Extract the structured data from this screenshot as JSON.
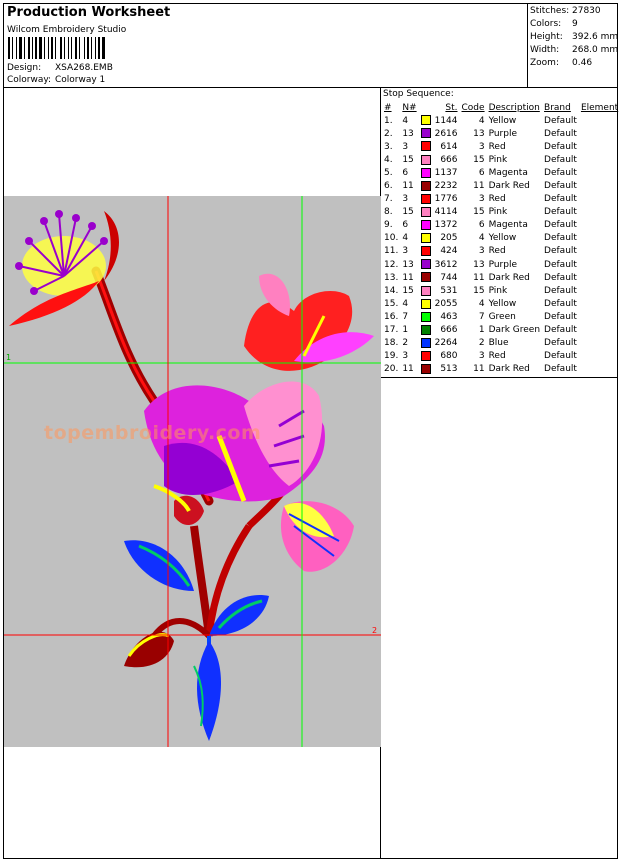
{
  "header": {
    "title": "Production Worksheet",
    "company": "Wilcom Embroidery Studio",
    "design_label": "Design:",
    "design_value": "XSA268.EMB",
    "colorway_label": "Colorway:",
    "colorway_value": "Colorway 1"
  },
  "stats": [
    {
      "label": "Stitches:",
      "value": "27830"
    },
    {
      "label": "Colors:",
      "value": "9"
    },
    {
      "label": "Height:",
      "value": "392.6 mm"
    },
    {
      "label": "Width:",
      "value": "268.0 mm"
    },
    {
      "label": "Zoom:",
      "value": "0.46"
    }
  ],
  "preview": {
    "watermark": "topembroidery.com",
    "background": "#c0c0c0",
    "guide_h_labels": [
      "1",
      "2"
    ]
  },
  "stop_sequence": {
    "title": "Stop Sequence:",
    "columns": [
      "#",
      "N#",
      "St.",
      "Code",
      "Description",
      "Brand",
      "Element"
    ],
    "rows": [
      {
        "idx": "1.",
        "n": "4",
        "color": "#ffff00",
        "st": "1144",
        "code": "4",
        "desc": "Yellow",
        "brand": "Default"
      },
      {
        "idx": "2.",
        "n": "13",
        "color": "#9900cc",
        "st": "2616",
        "code": "13",
        "desc": "Purple",
        "brand": "Default"
      },
      {
        "idx": "3.",
        "n": "3",
        "color": "#ff0000",
        "st": "614",
        "code": "3",
        "desc": "Red",
        "brand": "Default"
      },
      {
        "idx": "4.",
        "n": "15",
        "color": "#ff80c0",
        "st": "666",
        "code": "15",
        "desc": "Pink",
        "brand": "Default"
      },
      {
        "idx": "5.",
        "n": "6",
        "color": "#ff00ff",
        "st": "1137",
        "code": "6",
        "desc": "Magenta",
        "brand": "Default"
      },
      {
        "idx": "6.",
        "n": "11",
        "color": "#990000",
        "st": "2232",
        "code": "11",
        "desc": "Dark Red",
        "brand": "Default"
      },
      {
        "idx": "7.",
        "n": "3",
        "color": "#ff0000",
        "st": "1776",
        "code": "3",
        "desc": "Red",
        "brand": "Default"
      },
      {
        "idx": "8.",
        "n": "15",
        "color": "#ff80c0",
        "st": "4114",
        "code": "15",
        "desc": "Pink",
        "brand": "Default"
      },
      {
        "idx": "9.",
        "n": "6",
        "color": "#ff00ff",
        "st": "1372",
        "code": "6",
        "desc": "Magenta",
        "brand": "Default"
      },
      {
        "idx": "10.",
        "n": "4",
        "color": "#ffff00",
        "st": "205",
        "code": "4",
        "desc": "Yellow",
        "brand": "Default"
      },
      {
        "idx": "11.",
        "n": "3",
        "color": "#ff0000",
        "st": "424",
        "code": "3",
        "desc": "Red",
        "brand": "Default"
      },
      {
        "idx": "12.",
        "n": "13",
        "color": "#9900cc",
        "st": "3612",
        "code": "13",
        "desc": "Purple",
        "brand": "Default"
      },
      {
        "idx": "13.",
        "n": "11",
        "color": "#990000",
        "st": "744",
        "code": "11",
        "desc": "Dark Red",
        "brand": "Default"
      },
      {
        "idx": "14.",
        "n": "15",
        "color": "#ff80c0",
        "st": "531",
        "code": "15",
        "desc": "Pink",
        "brand": "Default"
      },
      {
        "idx": "15.",
        "n": "4",
        "color": "#ffff00",
        "st": "2055",
        "code": "4",
        "desc": "Yellow",
        "brand": "Default"
      },
      {
        "idx": "16.",
        "n": "7",
        "color": "#00ff00",
        "st": "463",
        "code": "7",
        "desc": "Green",
        "brand": "Default"
      },
      {
        "idx": "17.",
        "n": "1",
        "color": "#008000",
        "st": "666",
        "code": "1",
        "desc": "Dark Green",
        "brand": "Default"
      },
      {
        "idx": "18.",
        "n": "2",
        "color": "#0033ff",
        "st": "2264",
        "code": "2",
        "desc": "Blue",
        "brand": "Default"
      },
      {
        "idx": "19.",
        "n": "3",
        "color": "#ff0000",
        "st": "680",
        "code": "3",
        "desc": "Red",
        "brand": "Default"
      },
      {
        "idx": "20.",
        "n": "11",
        "color": "#990000",
        "st": "513",
        "code": "11",
        "desc": "Dark Red",
        "brand": "Default"
      }
    ]
  }
}
